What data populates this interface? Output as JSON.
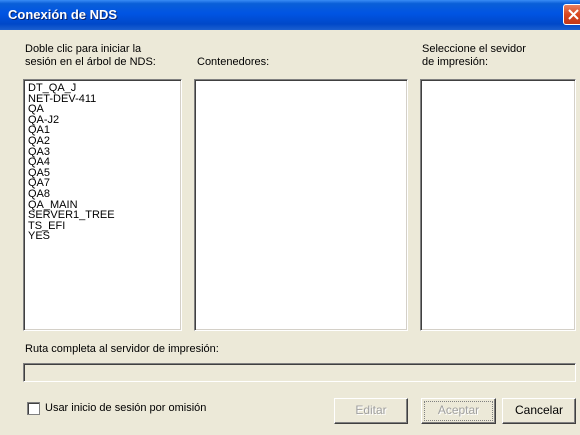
{
  "window": {
    "title": "Conexión de NDS"
  },
  "columns": {
    "tree_label_line1": "Doble clic para iniciar la",
    "tree_label_line2": "sesión en el árbol de NDS:",
    "containers_label": "Contenedores:",
    "printserver_label_line1": "Seleccione el sevidor",
    "printserver_label_line2": "de impresión:"
  },
  "tree_items": [
    "DT_QA_J",
    "NET-DEV-411",
    "QA",
    "QA-J2",
    "QA1",
    "QA2",
    "QA3",
    "QA4",
    "QA5",
    "QA7",
    "QA8",
    "QA_MAIN",
    "SERVER1_TREE",
    "TS_EFI",
    "YES"
  ],
  "path": {
    "label": "Ruta completa al servidor de impresión:",
    "value": ""
  },
  "checkbox": {
    "label": "Usar inicio de sesión por omisión",
    "checked": false
  },
  "buttons": {
    "edit": "Editar",
    "accept": "Aceptar",
    "cancel": "Cancelar"
  }
}
